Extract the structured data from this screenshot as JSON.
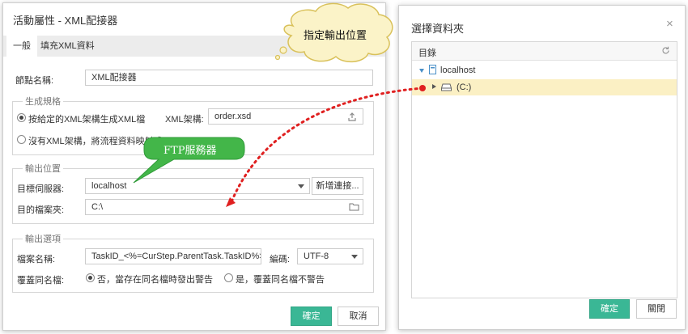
{
  "left_dialog": {
    "title": "活動屬性 - XML配接器",
    "tabs": [
      {
        "label": "一般"
      },
      {
        "label": "填充XML資料"
      }
    ],
    "node_name": {
      "label": "節點名稱:",
      "value": "XML配接器"
    },
    "generate": {
      "legend": "生成規格",
      "option1": "按給定的XML架構生成XML檔",
      "schema_label": "XML架構:",
      "schema_value": "order.xsd",
      "option2": "沒有XML架構，將流程資料映射成"
    },
    "output_location": {
      "legend": "輸出位置",
      "server_label": "目標伺服器:",
      "server_value": "localhost",
      "new_connection": "新增連接...",
      "folder_label": "目的檔案夾:",
      "folder_value": "C:\\"
    },
    "output_options": {
      "legend": "輸出選項",
      "filename_label": "檔案名稱:",
      "filename_value": "TaskID_<%=CurStep.ParentTask.TaskID%>.xml",
      "encoding_label": "編碼:",
      "encoding_value": "UTF-8",
      "overwrite_label": "覆蓋同名檔:",
      "overwrite_no": "否，當存在同名檔時發出警告",
      "overwrite_yes": "是，覆蓋同名檔不警告"
    },
    "confirm": "確定",
    "cancel": "取消"
  },
  "right_dialog": {
    "title": "選擇資料夾",
    "close": "×",
    "tree_header": "目錄",
    "root": "localhost",
    "child": "(C:)",
    "confirm": "確定",
    "close_button": "關閉"
  },
  "callouts": {
    "cloud": "指定輸出位置",
    "bubble": "FTP服務器"
  },
  "colors": {
    "accent": "#3ab795",
    "selected_row": "#fbf0c4",
    "arrow": "#e02020",
    "bubble": "#43b649",
    "cloud_fill": "#fbf3c8",
    "cloud_stroke": "#d9c15a"
  }
}
